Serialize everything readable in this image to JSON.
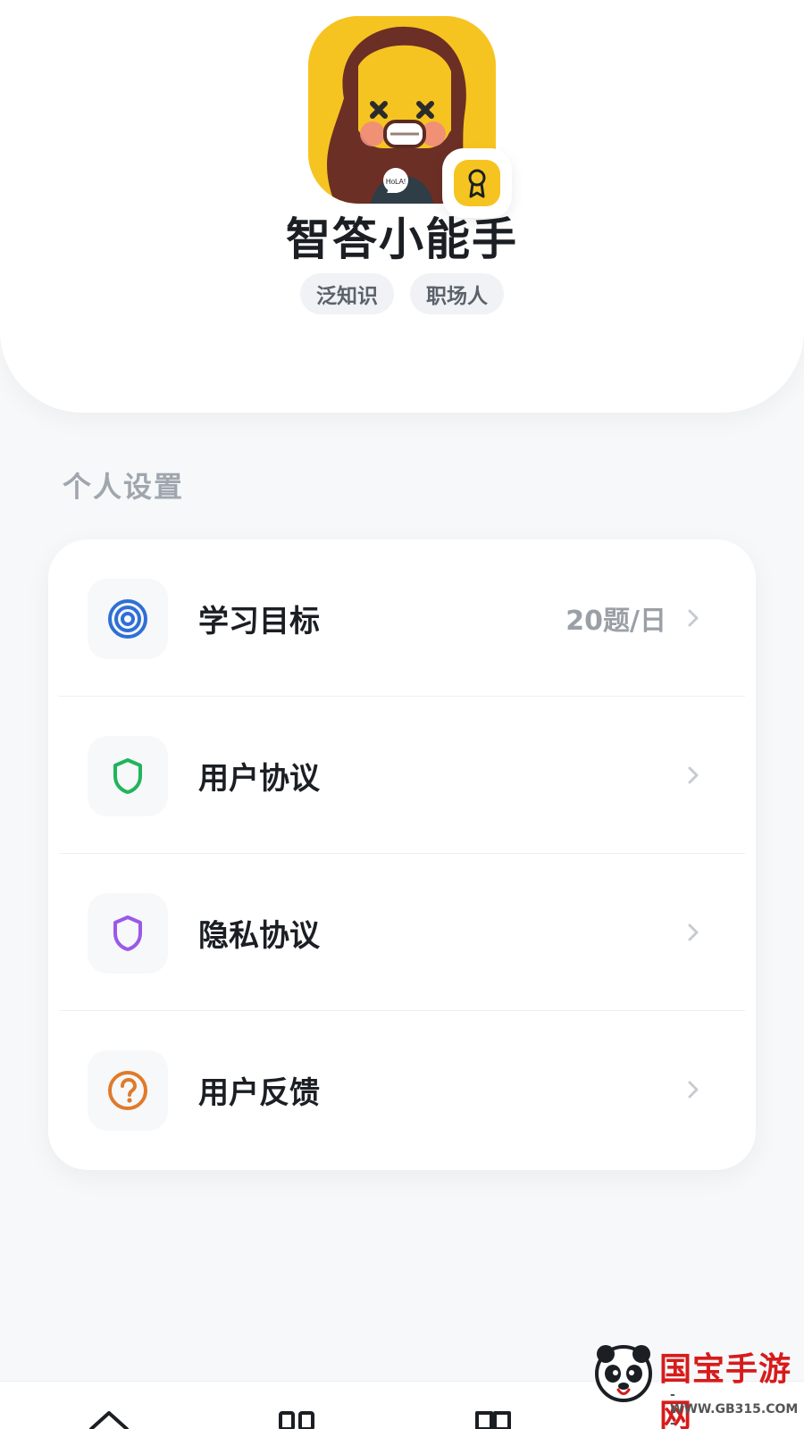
{
  "profile": {
    "name": "智答小能手",
    "tags": [
      "泛知识",
      "职场人"
    ]
  },
  "settings": {
    "section_title": "个人设置",
    "items": [
      {
        "label": "学习目标",
        "value": "20题/日",
        "icon": "target-icon"
      },
      {
        "label": "用户协议",
        "value": "",
        "icon": "shield-icon"
      },
      {
        "label": "隐私协议",
        "value": "",
        "icon": "shield-icon"
      },
      {
        "label": "用户反馈",
        "value": "",
        "icon": "question-circle-icon"
      }
    ]
  },
  "watermark": {
    "title": "国宝手游网",
    "sub": "- WWW.GB315.COM -"
  },
  "colors": {
    "accent_yellow": "#f6c421",
    "target_blue": "#2f6fd6",
    "shield_green": "#20b55a",
    "shield_purple": "#9b59e6",
    "question_orange": "#e07a2a"
  }
}
